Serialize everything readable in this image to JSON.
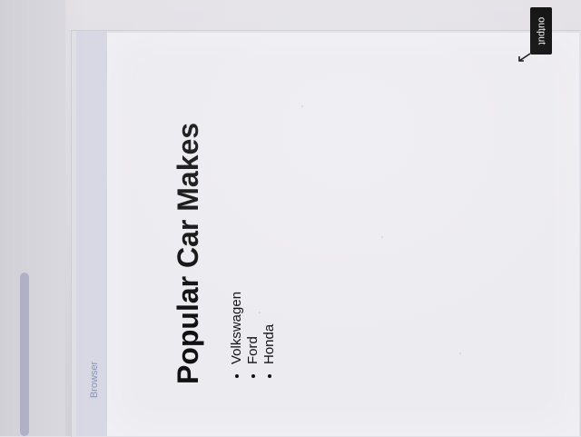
{
  "browser": {
    "label": "Browser"
  },
  "page": {
    "title": "Popular Car Makes",
    "items": [
      "Volkswagen",
      "Ford",
      "Honda"
    ]
  },
  "badge": {
    "label": "output"
  },
  "icons": {
    "arrow": "arrow-down-left-icon"
  }
}
